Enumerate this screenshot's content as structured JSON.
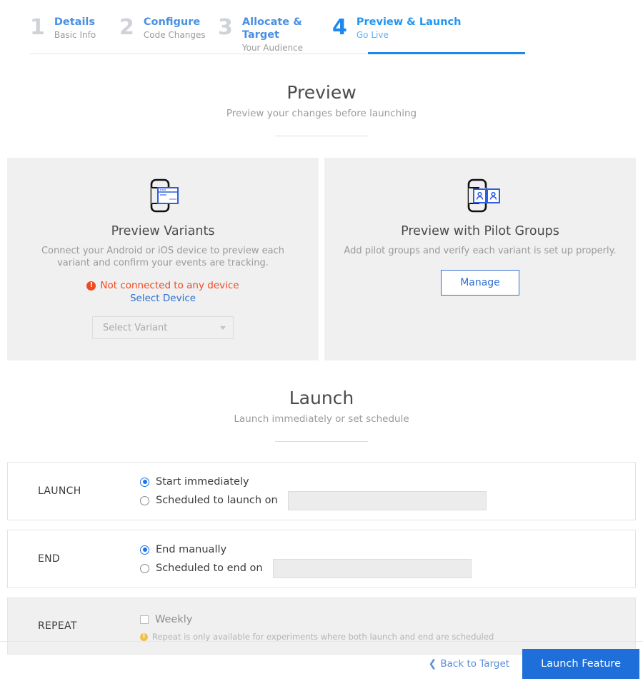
{
  "stepper": {
    "steps": [
      {
        "num": "1",
        "title": "Details",
        "subtitle": "Basic Info",
        "active": false
      },
      {
        "num": "2",
        "title": "Configure",
        "subtitle": "Code Changes",
        "active": false
      },
      {
        "num": "3",
        "title": "Allocate & Target",
        "subtitle": "Your Audience",
        "active": false
      },
      {
        "num": "4",
        "title": "Preview & Launch",
        "subtitle": "Go Live",
        "active": true
      }
    ]
  },
  "preview_section": {
    "heading": "Preview",
    "subheading": "Preview your changes before launching",
    "cards": [
      {
        "icon": "phone-browser-icon",
        "title": "Preview Variants",
        "description": "Connect your Android or iOS device to preview each variant and confirm your events are tracking.",
        "status_text": "Not connected to any device",
        "status_icon": "alert-circle-icon",
        "status_color": "#ef4a23",
        "link_label": "Select Device",
        "select_placeholder": "Select Variant"
      },
      {
        "icon": "phone-pilot-groups-icon",
        "title": "Preview with Pilot Groups",
        "description": "Add pilot groups and verify each variant is set up properly.",
        "button_label": "Manage"
      }
    ]
  },
  "launch_section": {
    "heading": "Launch",
    "subheading": "Launch immediately or set schedule",
    "rows": [
      {
        "label": "LAUNCH",
        "options": [
          {
            "text": "Start immediately",
            "selected": true,
            "has_date": false
          },
          {
            "text": "Scheduled to launch on",
            "selected": false,
            "has_date": true,
            "date_value": ""
          }
        ]
      },
      {
        "label": "END",
        "options": [
          {
            "text": "End manually",
            "selected": true,
            "has_date": false
          },
          {
            "text": "Scheduled to end on",
            "selected": false,
            "has_date": true,
            "date_value": ""
          }
        ]
      }
    ],
    "repeat_row": {
      "label": "REPEAT",
      "checkbox_label": "Weekly",
      "checked": false,
      "hint_icon": "warning-circle-icon",
      "hint": "Repeat is only available for experiments where both launch and end are scheduled",
      "hint_color": "#eec14a",
      "disabled": true
    }
  },
  "footer": {
    "back_label": "Back to Target",
    "back_icon": "chevron-left-icon",
    "primary_label": "Launch Feature",
    "primary_color": "#1e6fd9"
  }
}
